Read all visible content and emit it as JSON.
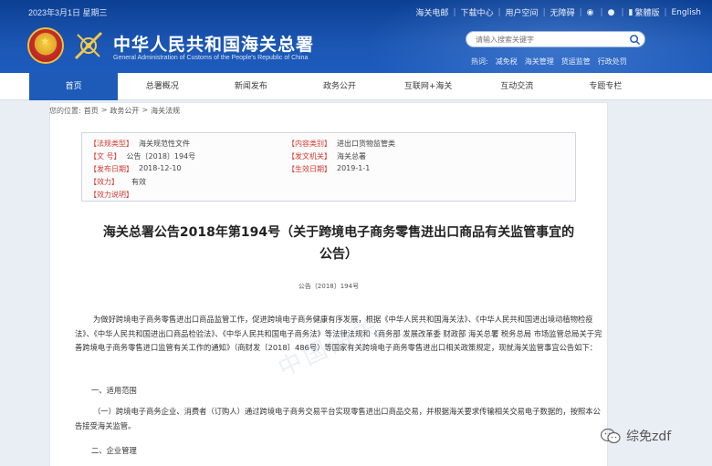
{
  "header": {
    "date": "2023年3月1日 星期三",
    "top_links": [
      "海关电邮",
      "下载中心",
      "用户空间",
      "无障碍",
      "繁體版",
      "English"
    ],
    "site_title": "中华人民共和国海关总署",
    "site_subtitle": "General Administration of Customs of the People's Republic of China",
    "search_placeholder": "请输入搜索关键字",
    "hotwords_label": "热词:",
    "hotwords": [
      "减免税",
      "海关管理",
      "货运监管",
      "行政处罚"
    ]
  },
  "nav": {
    "items": [
      "首页",
      "总署概况",
      "新闻发布",
      "政务公开",
      "互联网+海关",
      "互动交流",
      "专题专栏"
    ],
    "active_index": 0
  },
  "breadcrumb": {
    "label": "您的位置:",
    "items": [
      "首页",
      "政务公开",
      "海关法规"
    ],
    "separator": ">"
  },
  "meta": {
    "category_label": "【法规类型】",
    "category_value": "海关规范性文件",
    "content_type_label": "【内容类别】",
    "content_type_value": "进出口货物监管类",
    "doc_no_label": "【文        号】",
    "doc_no_value": "公告〔2018〕194号",
    "issuer_label": "【发文机关】",
    "issuer_value": "海关总署",
    "issue_date_label": "【发布日期】",
    "issue_date_value": "2018-12-10",
    "effective_date_label": "【生效日期】",
    "effective_date_value": "2019-1-1",
    "validity_label": "【效力】",
    "validity_value": "有效",
    "validity_note_label": "【效力说明】"
  },
  "document": {
    "title_line1": "海关总署公告2018年第194号（关于跨境电子商务零售进出口商品有关监管事宜的",
    "title_line2": "公告）",
    "number": "公告〔2018〕194号",
    "para1": "为做好跨境电子商务零售进出口商品监管工作，促进跨境电子商务健康有序发展，根据《中华人民共和国海关法》、《中华人民共和国进出境动植物检疫法》、《中华人民共和国进出口商品检验法》、《中华人民共和国电子商务法》等法律法规和《商务部 发展改革委 财政部 海关总署 税务总局 市场监管总局关于完善跨境电子商务零售进口监管有关工作的通知》（商财发〔2018〕486号）等国家有关跨境电子商务零售进出口相关政策规定，现就海关监管事宜公告如下：",
    "section1": "一、适用范围",
    "sub1": "（一）跨境电子商务企业、消费者（订购人）通过跨境电子商务交易平台实现零售进出口商品交易，并根据海关要求传输相关交易电子数据的，按照本公告接受海关监管。",
    "section2": "二、企业管理"
  },
  "overlay": {
    "wechat_account": "综免zdf"
  }
}
